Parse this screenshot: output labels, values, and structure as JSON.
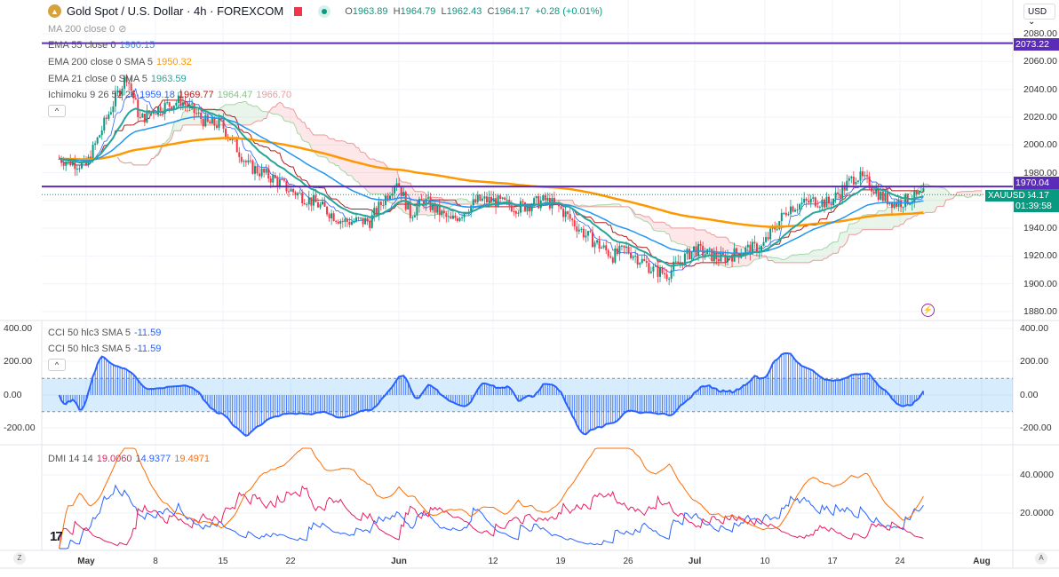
{
  "header": {
    "symbol_title": "Gold Spot / U.S. Dollar · 4h · FOREXCOM",
    "open_label": "O",
    "open": "1963.89",
    "high_label": "H",
    "high": "1964.79",
    "low_label": "L",
    "low": "1962.43",
    "close_label": "C",
    "close": "1964.17",
    "change": "+0.28 (+0.01%)"
  },
  "legends": {
    "ma200": "MA 200 close 0",
    "ema55": "EMA 55 close 0",
    "ema55_val": "1960.15",
    "ema200": "EMA 200 close 0 SMA 5",
    "ema200_val": "1950.32",
    "ema21": "EMA 21 close 0 SMA 5",
    "ema21_val": "1963.59",
    "ichimoku": "Ichimoku 9 26 52 26",
    "ichi_1": "1959.18",
    "ichi_2": "1969.77",
    "ichi_3": "1964.47",
    "ichi_4": "1966.70",
    "cci1": "CCI 50 hlc3 SMA 5",
    "cci1_val": "-11.59",
    "cci2": "CCI 50 hlc3 SMA 5",
    "cci2_val": "-11.59",
    "dmi": "DMI 14 14",
    "dmi_plus": "19.0060",
    "dmi_minus": "14.9377",
    "dmi_adx": "19.4971",
    "collapse": "^"
  },
  "price_axis": {
    "currency": "USD",
    "ticks": [
      "2080.00",
      "2060.00",
      "2040.00",
      "2020.00",
      "2000.00",
      "1980.00",
      "1960.00",
      "1940.00",
      "1920.00",
      "1900.00",
      "1880.00"
    ],
    "line1": "2073.22",
    "line2": "1970.04",
    "last": "1964.17",
    "countdown": "01:39:58",
    "symbol_tag": "XAUUSD"
  },
  "cci_axis": {
    "ticks": [
      "400.00",
      "200.00",
      "0.00",
      "-200.00"
    ]
  },
  "dmi_axis": {
    "ticks": [
      "40.0000",
      "20.0000"
    ]
  },
  "time_axis": {
    "labels": [
      "May",
      "8",
      "15",
      "22",
      "Jun",
      "12",
      "19",
      "26",
      "Jul",
      "10",
      "17",
      "24",
      "Aug"
    ],
    "left_btn": "Z",
    "right_btn": "A"
  },
  "logo": "TV",
  "colors": {
    "up": "#089981",
    "down": "#f23645",
    "ema55": "#2196f3",
    "ema200": "#ff9800",
    "ema21": "#26a69a",
    "hline": "#5b2cb8",
    "cci": "#2962ff",
    "dmi_plus": "#e91e63",
    "dmi_minus": "#2962ff",
    "adx": "#ff6d00"
  },
  "chart_data": {
    "type": "candlestick",
    "timeframe": "4h",
    "symbol": "XAUUSD",
    "ylim": [
      1875,
      2085
    ],
    "anchors": [
      [
        "2023-04-27",
        1990
      ],
      [
        "2023-05-01",
        1985
      ],
      [
        "2023-05-03",
        2030
      ],
      [
        "2023-05-04",
        2050
      ],
      [
        "2023-05-05",
        2018
      ],
      [
        "2023-05-08",
        2025
      ],
      [
        "2023-05-10",
        2032
      ],
      [
        "2023-05-12",
        2015
      ],
      [
        "2023-05-15",
        2015
      ],
      [
        "2023-05-17",
        1985
      ],
      [
        "2023-05-19",
        1975
      ],
      [
        "2023-05-22",
        1968
      ],
      [
        "2023-05-24",
        1958
      ],
      [
        "2023-05-26",
        1945
      ],
      [
        "2023-05-30",
        1945
      ],
      [
        "2023-06-01",
        1975
      ],
      [
        "2023-06-02",
        1950
      ],
      [
        "2023-06-05",
        1960
      ],
      [
        "2023-06-07",
        1945
      ],
      [
        "2023-06-09",
        1960
      ],
      [
        "2023-06-12",
        1960
      ],
      [
        "2023-06-14",
        1955
      ],
      [
        "2023-06-16",
        1960
      ],
      [
        "2023-06-19",
        1955
      ],
      [
        "2023-06-21",
        1935
      ],
      [
        "2023-06-23",
        1920
      ],
      [
        "2023-06-26",
        1925
      ],
      [
        "2023-06-28",
        1910
      ],
      [
        "2023-06-29",
        1907
      ],
      [
        "2023-07-03",
        1925
      ],
      [
        "2023-07-05",
        1918
      ],
      [
        "2023-07-07",
        1925
      ],
      [
        "2023-07-10",
        1926
      ],
      [
        "2023-07-12",
        1955
      ],
      [
        "2023-07-14",
        1960
      ],
      [
        "2023-07-17",
        1958
      ],
      [
        "2023-07-19",
        1978
      ],
      [
        "2023-07-20",
        1972
      ],
      [
        "2023-07-21",
        1962
      ],
      [
        "2023-07-24",
        1958
      ],
      [
        "2023-07-26",
        1964
      ]
    ],
    "hlines": [
      2073.22,
      1970.04
    ],
    "cci_ylim": [
      -300,
      400
    ],
    "cci_band": [
      -100,
      100
    ],
    "dmi_ylim": [
      0,
      50
    ]
  }
}
